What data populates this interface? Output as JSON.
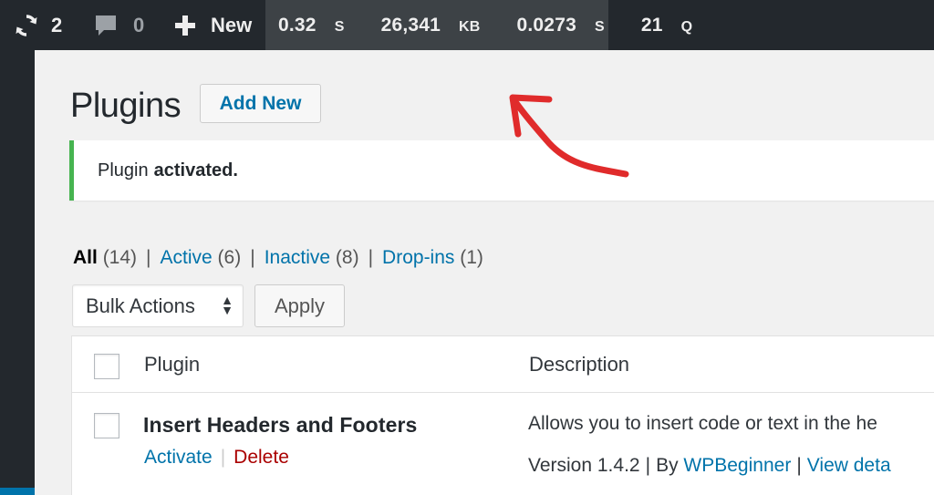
{
  "adminbar": {
    "updates_count": "2",
    "comments_count": "0",
    "new_label": "New",
    "query_monitor": {
      "time": "0.32",
      "time_unit": "S",
      "memory": "26,341",
      "memory_unit": "KB",
      "db_time": "0.0273",
      "db_time_unit": "S",
      "queries": "21",
      "queries_unit": "Q"
    }
  },
  "page": {
    "title": "Plugins",
    "add_new_label": "Add New"
  },
  "notice": {
    "prefix": "Plugin",
    "bold": "activated."
  },
  "filters": {
    "all_label": "All",
    "all_count": "(14)",
    "active_label": "Active",
    "active_count": "(6)",
    "inactive_label": "Inactive",
    "inactive_count": "(8)",
    "dropins_label": "Drop-ins",
    "dropins_count": "(1)",
    "separator": "|"
  },
  "bulk": {
    "selected": "Bulk Actions",
    "apply_label": "Apply"
  },
  "table": {
    "col_plugin": "Plugin",
    "col_description": "Description",
    "rows": [
      {
        "name": "Insert Headers and Footers",
        "activate_label": "Activate",
        "delete_label": "Delete",
        "description": "Allows you to insert code or text in the he",
        "version": "Version 1.4.2",
        "by_label": "By",
        "author": "WPBeginner",
        "details_label": "View deta"
      }
    ]
  },
  "colors": {
    "adminbar_bg": "#23282d",
    "query_monitor_bg": "#3d4246",
    "link": "#0073aa",
    "delete": "#a00",
    "notice_success": "#46b450",
    "annotation_arrow": "#e02b2b"
  }
}
